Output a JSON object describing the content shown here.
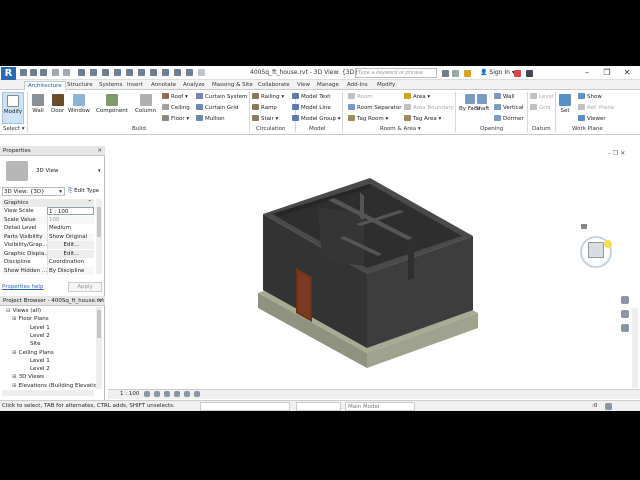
{
  "titlebar": {
    "logo": "R",
    "title": "4005q_ft_house.rvt - 3D View: {3D}",
    "search_placeholder": "Type a keyword or phrase",
    "sign_in": "Sign In"
  },
  "tabs": [
    "Architecture",
    "Structure",
    "Systems",
    "Insert",
    "Annotate",
    "Analyze",
    "Massing & Site",
    "Collaborate",
    "View",
    "Manage",
    "Add-Ins",
    "Modify"
  ],
  "active_tab": "Architecture",
  "ribbon": {
    "select_label": "Select ▾",
    "modify": "Modify",
    "build": {
      "label": "Build",
      "big": [
        "Wall",
        "Door",
        "Window",
        "Component",
        "Column"
      ],
      "col1": [
        "Roof ▾",
        "Ceiling",
        "Floor ▾"
      ],
      "col2": [
        "Curtain System",
        "Curtain Grid",
        "Mullion"
      ],
      "col3": [
        "Railing ▾",
        "Ramp",
        "Stair ▾"
      ]
    },
    "circulation": "Circulation",
    "model": {
      "label": "Model",
      "items": [
        "Model Text",
        "Model Line",
        "Model Group ▾"
      ]
    },
    "room_area": {
      "label": "Room & Area ▾",
      "col1": [
        "Room",
        "Room Separator",
        "Tag Room ▾"
      ],
      "col2": [
        "Area ▾",
        "Area Boundary",
        "Tag Area ▾"
      ]
    },
    "opening": {
      "label": "Opening",
      "big": [
        "By Face",
        "Shaft"
      ],
      "items": [
        "Wall",
        "Vertical",
        "Dormer"
      ]
    },
    "datum": {
      "label": "Datum",
      "items": [
        "Level",
        "Grid"
      ]
    },
    "work_plane": {
      "label": "Work Plane",
      "big": "Set",
      "items": [
        "Show",
        "Ref. Plane",
        "Viewer"
      ]
    }
  },
  "properties": {
    "title": "Properties",
    "type": "3D View",
    "selector": "3D View: {3D}",
    "edit_type": "Edit Type",
    "section": "Graphics",
    "rows": [
      {
        "k": "View Scale",
        "v": "1 : 100"
      },
      {
        "k": "Scale Value",
        "v": "100"
      },
      {
        "k": "Detail Level",
        "v": "Medium"
      },
      {
        "k": "Parts Visibility",
        "v": "Show Original"
      },
      {
        "k": "Visibility/Grap...",
        "v": "Edit..."
      },
      {
        "k": "Graphic Displa...",
        "v": "Edit..."
      },
      {
        "k": "Discipline",
        "v": "Coordination"
      },
      {
        "k": "Show Hidden ...",
        "v": "By Discipline"
      }
    ],
    "help": "Properties help",
    "apply": "Apply"
  },
  "browser": {
    "title": "Project Browser - 400Sq_ft_house.rvt",
    "tree": [
      {
        "t": "Views (all)",
        "lvl": 0
      },
      {
        "t": "Floor Plans",
        "lvl": 1
      },
      {
        "t": "Level 1",
        "lvl": 2
      },
      {
        "t": "Level 2",
        "lvl": 2
      },
      {
        "t": "Site",
        "lvl": 2
      },
      {
        "t": "Ceiling Plans",
        "lvl": 1
      },
      {
        "t": "Level 1",
        "lvl": 2
      },
      {
        "t": "Level 2",
        "lvl": 2
      },
      {
        "t": "3D Views",
        "lvl": 1
      },
      {
        "t": "Elevations (Building Elevation",
        "lvl": 1
      }
    ]
  },
  "viewbar": {
    "scale": "1 : 100"
  },
  "statusbar": {
    "text": "Click to select, TAB for alternates, CTRL adds, SHIFT unselects.",
    "model": "Main Model",
    "count": ":0"
  },
  "colors": {
    "accent": "#1d5ba4",
    "wall": "#3a3a3a",
    "wall_top": "#4a4a4a",
    "slab": "#a7ab94",
    "door": "#7a3a1e"
  }
}
